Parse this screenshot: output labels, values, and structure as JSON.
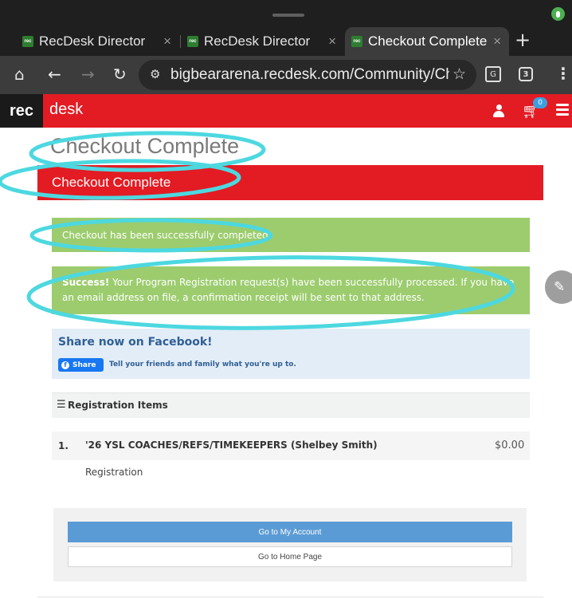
{
  "browser": {
    "tabs": [
      {
        "label": "RecDesk Director",
        "favicon": "rec"
      },
      {
        "label": "RecDesk Director",
        "favicon": "rec"
      },
      {
        "label": "Checkout Complete",
        "favicon": "rec",
        "active": true
      }
    ],
    "tab_close_glyph": "×",
    "new_tab_glyph": "+",
    "url": "bigbeararena.recdesk.com/Community/Ch",
    "tab_count": "3"
  },
  "site": {
    "logo_rec": "rec",
    "logo_desk": "desk",
    "cart_count": "0",
    "brand_color": "#e31b23"
  },
  "page": {
    "title": "Checkout Complete",
    "panel_heading": "Checkout Complete",
    "alert_completed": "Checkout has been successfully completed!",
    "alert_success_label": "Success!",
    "alert_success_text": " Your Program Registration request(s) have been successfully processed. If you have an email address on file, a confirmation receipt will be sent to that address.",
    "share": {
      "title": "Share now on Facebook!",
      "button_label": "Share",
      "tagline": "Tell your friends and family what you're up to."
    },
    "registration": {
      "heading": "Registration Items",
      "items": [
        {
          "number": "1.",
          "name": "'26 YSL COACHES/REFS/TIMEKEEPERS (Shelbey Smith)",
          "price": "$0.00",
          "type": "Registration"
        }
      ]
    },
    "buttons": {
      "my_account": "Go to My Account",
      "home_page": "Go to Home Page"
    }
  }
}
